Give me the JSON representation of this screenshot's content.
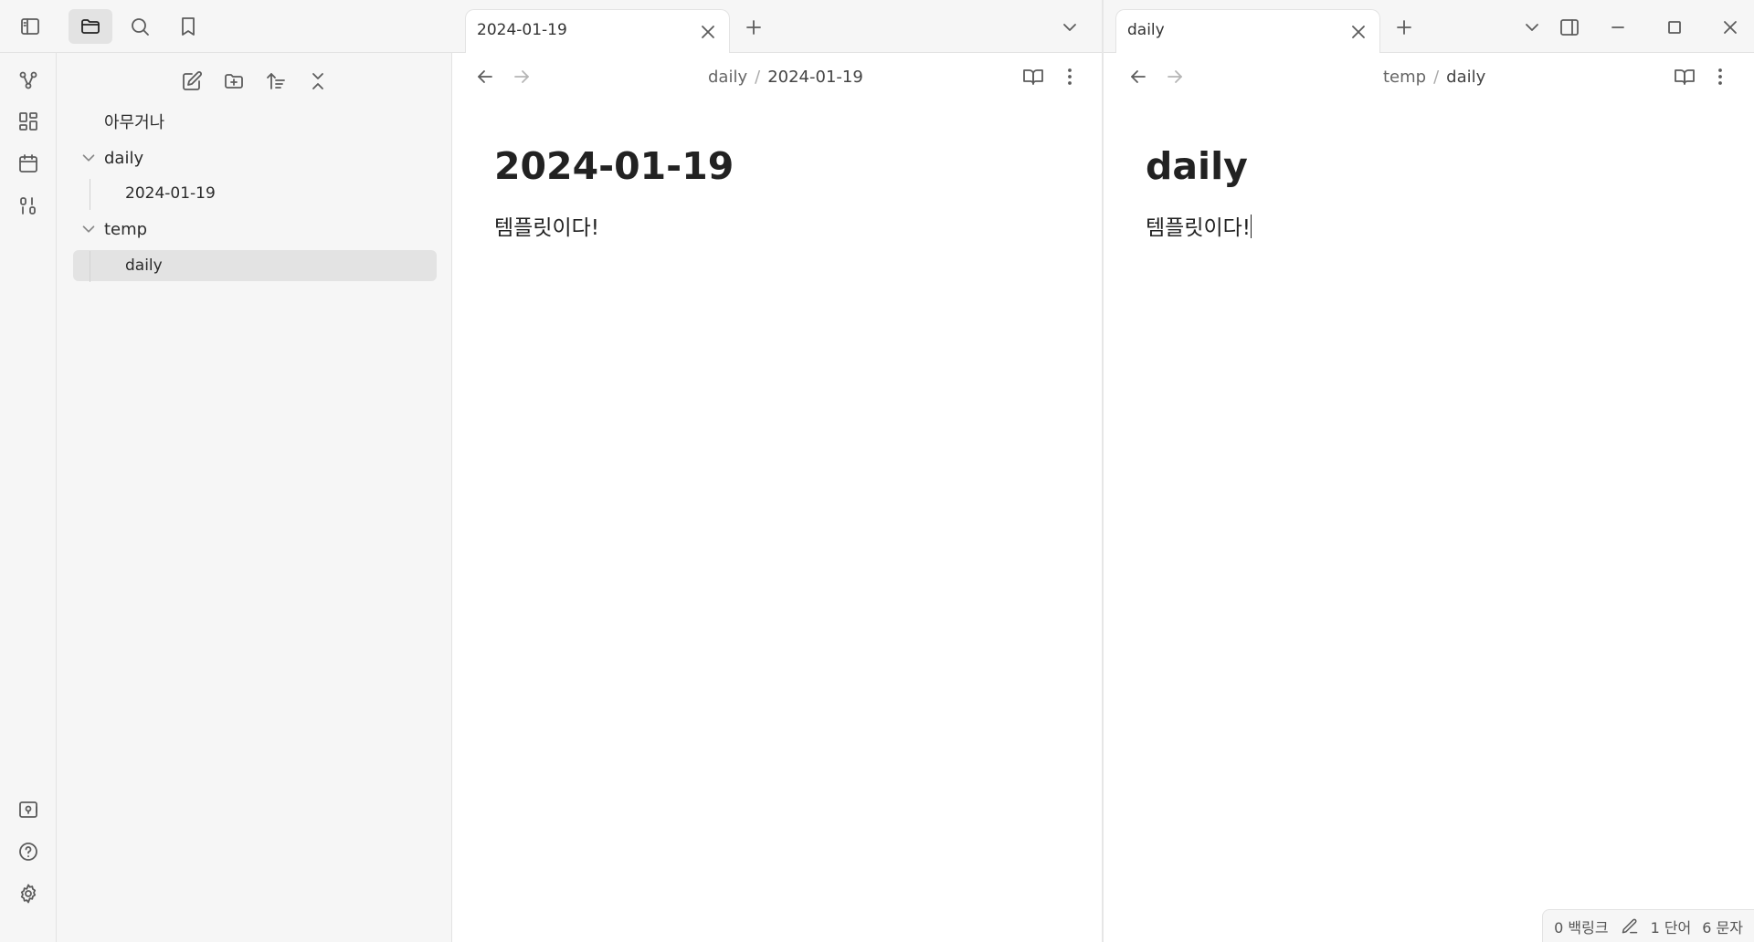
{
  "ribbon": {
    "top_icons": [
      "sidebar-toggle-icon"
    ],
    "icons": [
      "graph-icon",
      "canvas-icon",
      "calendar-icon",
      "template-icon"
    ],
    "bottom_icons": [
      "vault-switch-icon",
      "help-icon",
      "settings-icon"
    ]
  },
  "sidebar": {
    "tabs": [
      "files-icon",
      "search-icon",
      "bookmark-icon"
    ],
    "toolbar": [
      "new-note-icon",
      "new-folder-icon",
      "sort-icon",
      "collapse-all-icon"
    ],
    "tree": {
      "root_file": "아무거나",
      "folder1": {
        "name": "daily",
        "child": "2024-01-19"
      },
      "folder2": {
        "name": "temp",
        "child": "daily"
      }
    }
  },
  "left_pane": {
    "tab_title": "2024-01-19",
    "breadcrumb_folder": "daily",
    "breadcrumb_separator": "/",
    "breadcrumb_file": "2024-01-19",
    "doc_title": "2024-01-19",
    "doc_body": "템플릿이다!"
  },
  "right_pane": {
    "tab_title": "daily",
    "breadcrumb_folder": "temp",
    "breadcrumb_separator": "/",
    "breadcrumb_file": "daily",
    "doc_title": "daily",
    "doc_body": "템플릿이다!"
  },
  "status": {
    "backlinks": "0 백링크",
    "words": "1 단어",
    "chars": "6 문자"
  },
  "colors": {
    "background": "#f6f6f6",
    "editor": "#ffffff",
    "selected": "#e3e3e3"
  }
}
